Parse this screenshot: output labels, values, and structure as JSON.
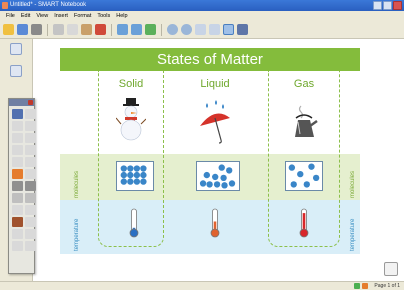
{
  "window": {
    "title": "Untitled* - SMART Notebook"
  },
  "menu": {
    "items": [
      "File",
      "Edit",
      "View",
      "Insert",
      "Format",
      "Tools",
      "Help"
    ]
  },
  "slide": {
    "title": "States of Matter",
    "columns": [
      {
        "label": "Solid",
        "object": "snowman-icon",
        "thermo_level": 0.2,
        "thermo_color": "#2a6fc2"
      },
      {
        "label": "Liquid",
        "object": "umbrella-icon",
        "thermo_level": 0.5,
        "thermo_color": "#e0622e"
      },
      {
        "label": "Gas",
        "object": "kettle-icon",
        "thermo_level": 0.9,
        "thermo_color": "#d8262a"
      }
    ],
    "row_labels": {
      "molecules": "molecules",
      "temperature": "temperature"
    }
  },
  "status": {
    "page_indicator": "Page 1 of 1"
  },
  "colors": {
    "title_band": "#84bc3c",
    "molecules_band": "#e5efcf",
    "temperature_band": "#d9eef8",
    "heading_text": "#6fa82d",
    "molecule": "#3a86c8"
  }
}
